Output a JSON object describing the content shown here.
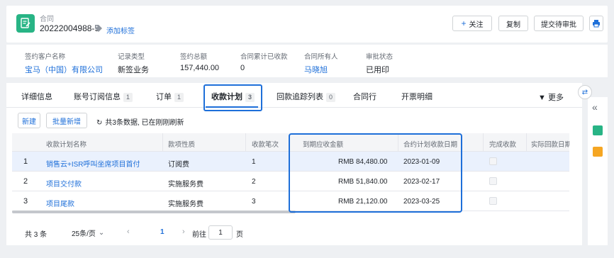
{
  "header": {
    "type_label": "合同",
    "code": "20222004988-9",
    "add_tag": "添加标签",
    "buttons": {
      "follow": "关注",
      "copy": "复制",
      "submit": "提交待审批"
    }
  },
  "summary": [
    {
      "label": "签约客户名称",
      "value": "宝马（中国）有限公司",
      "link": true
    },
    {
      "label": "记录类型",
      "value": "新签业务",
      "link": false
    },
    {
      "label": "签约总额",
      "value": "157,440.00",
      "link": false
    },
    {
      "label": "合同累计已收款",
      "value": "0",
      "link": false
    },
    {
      "label": "合同所有人",
      "value": "马晓旭",
      "link": true
    },
    {
      "label": "审批状态",
      "value": "已用印",
      "link": false
    }
  ],
  "tabs": [
    {
      "label": "详细信息",
      "count": ""
    },
    {
      "label": "账号订阅信息",
      "count": "1"
    },
    {
      "label": "订单",
      "count": "1"
    },
    {
      "label": "收款计划",
      "count": "3"
    },
    {
      "label": "回款追踪列表",
      "count": "0"
    },
    {
      "label": "合同行",
      "count": ""
    },
    {
      "label": "开票明细",
      "count": ""
    }
  ],
  "more_label": "更多",
  "toolbar": {
    "new": "新建",
    "batch": "批量新增",
    "refresh_text": "共3条数据, 已在刚刚刷新"
  },
  "table": {
    "columns": [
      "收款计划名称",
      "款项性质",
      "收款笔次",
      "到期应收金额",
      "合约计划收款日期",
      "完成收款",
      "实际回款日期"
    ],
    "rows": [
      {
        "idx": "1",
        "name": "销售云+ISR呼叫坐席项目首付",
        "nature": "订阅费",
        "seq": "1",
        "amount": "RMB 84,480.00",
        "date": "2023-01-09"
      },
      {
        "idx": "2",
        "name": "项目交付款",
        "nature": "实施服务费",
        "seq": "2",
        "amount": "RMB 51,840.00",
        "date": "2023-02-17"
      },
      {
        "idx": "3",
        "name": "项目尾款",
        "nature": "实施服务费",
        "seq": "3",
        "amount": "RMB 21,120.00",
        "date": "2023-03-25"
      }
    ]
  },
  "pager": {
    "total": "共 3 条",
    "size": "25条/页",
    "current": "1",
    "goto": "前往",
    "goto_value": "1",
    "unit": "页"
  },
  "colors": {
    "accent": "#1e6fd9",
    "brand_green": "#28b485"
  }
}
